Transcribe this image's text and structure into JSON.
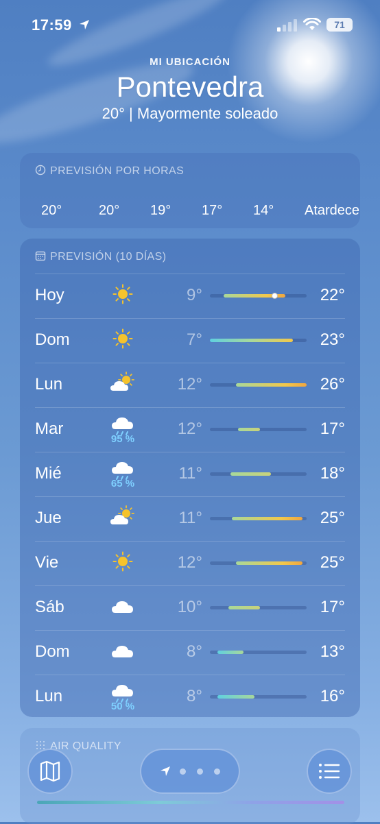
{
  "status_bar": {
    "time": "17:59",
    "battery": "71"
  },
  "location": {
    "label": "MI UBICACIÓN",
    "city": "Pontevedra",
    "summary": "20°  |  Mayormente soleado"
  },
  "hourly": {
    "title": "PREVISIÓN POR HORAS",
    "items": [
      "20°",
      "20°",
      "19°",
      "17°",
      "14°",
      "Atardecer"
    ]
  },
  "daily": {
    "title": "PREVISIÓN (10 DÍAS)",
    "days": [
      {
        "name": "Hoy",
        "icon": "sun-icon",
        "precip": "",
        "low": "9°",
        "high": "22°",
        "range_start": 0.14,
        "range_end": 0.78,
        "current": 0.67
      },
      {
        "name": "Dom",
        "icon": "sun-icon",
        "precip": "",
        "low": "7°",
        "high": "23°",
        "range_start": 0.0,
        "range_end": 0.86
      },
      {
        "name": "Lun",
        "icon": "partly-cloudy-icon",
        "precip": "",
        "low": "12°",
        "high": "26°",
        "range_start": 0.27,
        "range_end": 1.0
      },
      {
        "name": "Mar",
        "icon": "rain-icon",
        "precip": "95 %",
        "low": "12°",
        "high": "17°",
        "range_start": 0.29,
        "range_end": 0.52
      },
      {
        "name": "Mié",
        "icon": "rain-icon",
        "precip": "65 %",
        "low": "11°",
        "high": "18°",
        "range_start": 0.21,
        "range_end": 0.63
      },
      {
        "name": "Jue",
        "icon": "partly-cloudy-icon",
        "precip": "",
        "low": "11°",
        "high": "25°",
        "range_start": 0.23,
        "range_end": 0.96
      },
      {
        "name": "Vie",
        "icon": "sun-icon",
        "precip": "",
        "low": "12°",
        "high": "25°",
        "range_start": 0.27,
        "range_end": 0.96
      },
      {
        "name": "Sáb",
        "icon": "cloud-icon",
        "precip": "",
        "low": "10°",
        "high": "17°",
        "range_start": 0.19,
        "range_end": 0.52
      },
      {
        "name": "Dom",
        "icon": "cloud-icon",
        "precip": "",
        "low": "8°",
        "high": "13°",
        "range_start": 0.08,
        "range_end": 0.35
      },
      {
        "name": "Lun",
        "icon": "rain-icon",
        "precip": "50 %",
        "low": "8°",
        "high": "16°",
        "range_start": 0.08,
        "range_end": 0.46
      }
    ]
  },
  "air_quality": {
    "title": "AIR QUALITY"
  },
  "colors": {
    "cool": "#5fd0e0",
    "mild": "#a8d89a",
    "warm": "#f2c84b",
    "hot": "#f0a640"
  }
}
